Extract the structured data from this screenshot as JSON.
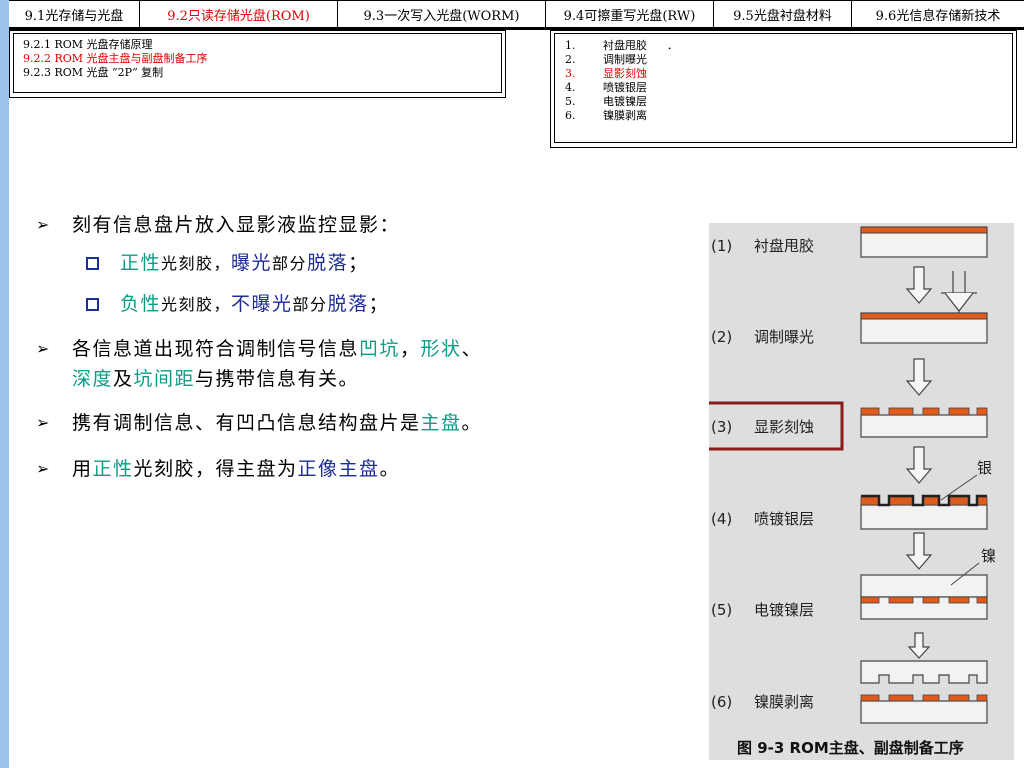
{
  "tabs": [
    {
      "label": "9.1光存储与光盘",
      "active": false
    },
    {
      "label": "9.2只读存储光盘(ROM)",
      "active": true
    },
    {
      "label": "9.3一次写入光盘(WORM)",
      "active": false
    },
    {
      "label": "9.4可擦重写光盘(RW)",
      "active": false
    },
    {
      "label": "9.5光盘衬盘材料",
      "active": false
    },
    {
      "label": "9.6光信息存储新技术",
      "active": false
    }
  ],
  "subsections": [
    {
      "label": "9.2.1 ROM 光盘存储原理",
      "active": false
    },
    {
      "label": "9.2.2 ROM 光盘主盘与副盘制备工序",
      "active": true
    },
    {
      "label": "9.2.3 ROM 光盘 “2P” 复制",
      "active": false
    }
  ],
  "steps": [
    {
      "num": "1.",
      "label": "衬盘甩胶",
      "extra": "．",
      "active": false
    },
    {
      "num": "2.",
      "label": "调制曝光",
      "extra": "",
      "active": false
    },
    {
      "num": "3.",
      "label": "显影刻蚀",
      "extra": "",
      "active": true
    },
    {
      "num": "4.",
      "label": "喷镀银层",
      "extra": "",
      "active": false
    },
    {
      "num": "5.",
      "label": "电镀镍层",
      "extra": "",
      "active": false
    },
    {
      "num": "6.",
      "label": "镍膜剥离",
      "extra": "",
      "active": false
    }
  ],
  "bullets": {
    "b1": "刻有信息盘片放入显影液监控显影：",
    "sub1": {
      "t1": "正性",
      "t2": "光刻胶，",
      "t3": "曝光",
      "t4": "部分",
      "t5": "脱落",
      "t6": "；"
    },
    "sub2": {
      "t1": "负性",
      "t2": "光刻胶，",
      "t3": "不曝光",
      "t4": "部分",
      "t5": "脱落",
      "t6": "；"
    },
    "b2": {
      "t1": "各信息道出现符合调制信号信息",
      "t2": "凹坑",
      "t3": "，",
      "t4": "形状",
      "t5": "、",
      "t6": "深度",
      "t7": "及",
      "t8": "坑间距",
      "t9": "与携带信息有关。"
    },
    "b3": {
      "t1": "携有调制信息、有凹凸信息结构盘片是",
      "t2": "主盘",
      "t3": "。"
    },
    "b4": {
      "t1": "用",
      "t2": "正性",
      "t3": "光刻胶，得主盘为",
      "t4": "正像主盘",
      "t5": "。"
    }
  },
  "figure": {
    "caption": "图 9-3 ROM主盘、副盘制备工序",
    "labels": [
      {
        "num": "(1)",
        "text": "衬盘甩胶"
      },
      {
        "num": "(2)",
        "text": "调制曝光"
      },
      {
        "num": "(3)",
        "text": "显影刻蚀"
      },
      {
        "num": "(4)",
        "text": "喷镀银层"
      },
      {
        "num": "(5)",
        "text": "电镀镍层"
      },
      {
        "num": "(6)",
        "text": "镍膜剥离"
      }
    ],
    "silver_label": "银",
    "nickel_label": "镍",
    "colors": {
      "substrate": "#f2f2f2",
      "resist": "#e05a1c",
      "highlight": "#8a1c1c",
      "background": "#dedede"
    }
  }
}
